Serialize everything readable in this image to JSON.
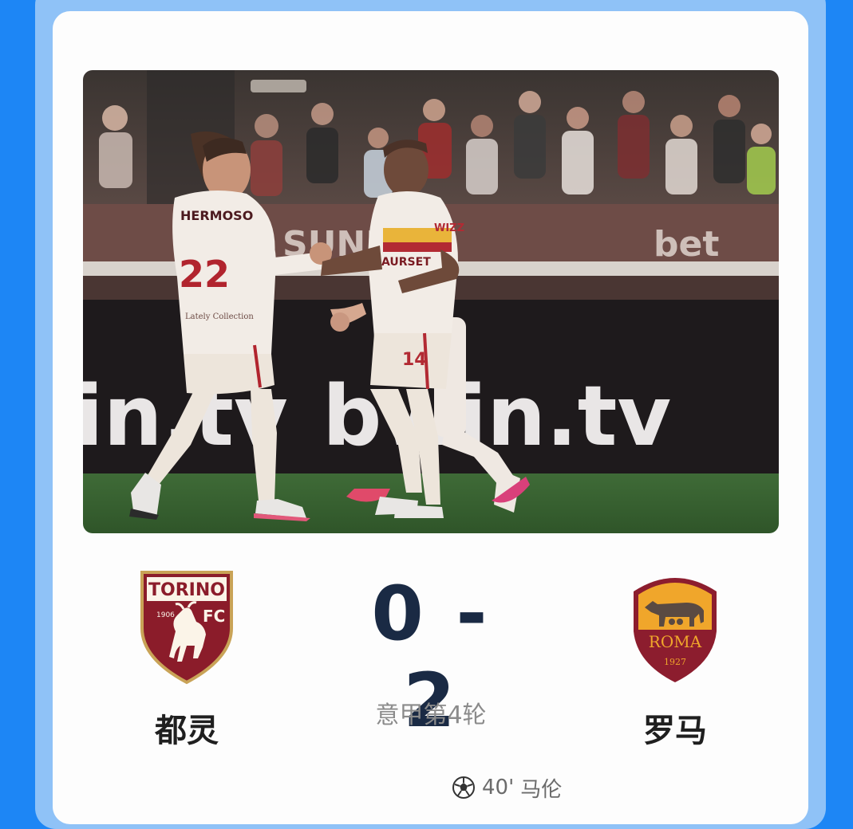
{
  "match": {
    "home_team": "都灵",
    "away_team": "罗马",
    "score": "0 - 2",
    "round": "意甲第4轮",
    "home_badge_text": {
      "name": "TORINO",
      "suffix": "FC",
      "year": "1906"
    },
    "away_badge_text": {
      "name": "ROMA",
      "year": "1927"
    }
  },
  "goal_event": {
    "icon": "soccer-ball-icon",
    "minute": "40'",
    "player": "马伦"
  },
  "photo": {
    "shirt_number_left": "22",
    "shirt_name_left": "HERMOSO",
    "shirt_number_right": "14",
    "shirt_sponsor_right": "AURSET",
    "board_text": "bwin.tv",
    "board_text_left": "in.tv",
    "upper_board_text": "SUNKI",
    "upper_board_text_right": "bet",
    "left_shirt_small_text": "Lately Collection",
    "sleeve_text": "WIZZ"
  },
  "colors": {
    "page_bg": "#1d86f5",
    "frame": "#8fc2f7",
    "card": "#fdfdfd",
    "score": "#1a2a44",
    "torino_maroon": "#8b1c2a",
    "roma_yellow": "#f0a62b",
    "roma_red": "#8c1d2e"
  }
}
